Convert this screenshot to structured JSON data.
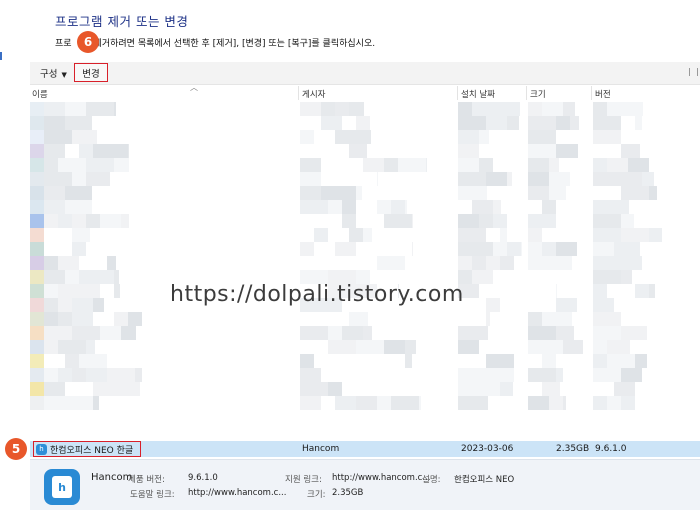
{
  "page": {
    "title": "프로그램 제거 또는 변경",
    "instruction_prefix": "프로",
    "instruction_suffix": "제거하려면 목록에서 선택한 후 [제거], [변경] 또는 [복구]를 클릭하십시오."
  },
  "badges": {
    "step5": "5",
    "step6": "6"
  },
  "toolbar": {
    "organize_label": "구성",
    "change_label": "변경"
  },
  "columns": {
    "name": "이름",
    "publisher": "게시자",
    "installed_on": "설치 날짜",
    "size": "크기",
    "version": "버전"
  },
  "watermark": "https://dolpali.tistory.com",
  "selected_program": {
    "name": "한컴오피스 NEO 한글",
    "publisher": "Hancom",
    "installed_on": "2023-03-06",
    "size": "2.35GB",
    "version": "9.6.1.0"
  },
  "details": {
    "publisher": "Hancom",
    "product_version_label": "제품 버전:",
    "product_version": "9.6.1.0",
    "support_link_label": "지원 링크:",
    "support_link": "http://www.hancom.c...",
    "description_label": "설명:",
    "description": "한컴오피스 NEO",
    "help_link_label": "도움말 링크:",
    "help_link": "http://www.hancom.c...",
    "size_label": "크기:",
    "size": "2.35GB"
  },
  "colors": {
    "title": "#1e3287",
    "badge": "#e8572a",
    "highlight_border": "#d8202a",
    "selection": "#cce4f7",
    "app_icon": "#2a8ad4"
  },
  "icons": [
    "dropdown-caret-icon",
    "sort-ascending-icon",
    "view-options-icon",
    "hancom-small-icon",
    "hancom-large-icon"
  ]
}
